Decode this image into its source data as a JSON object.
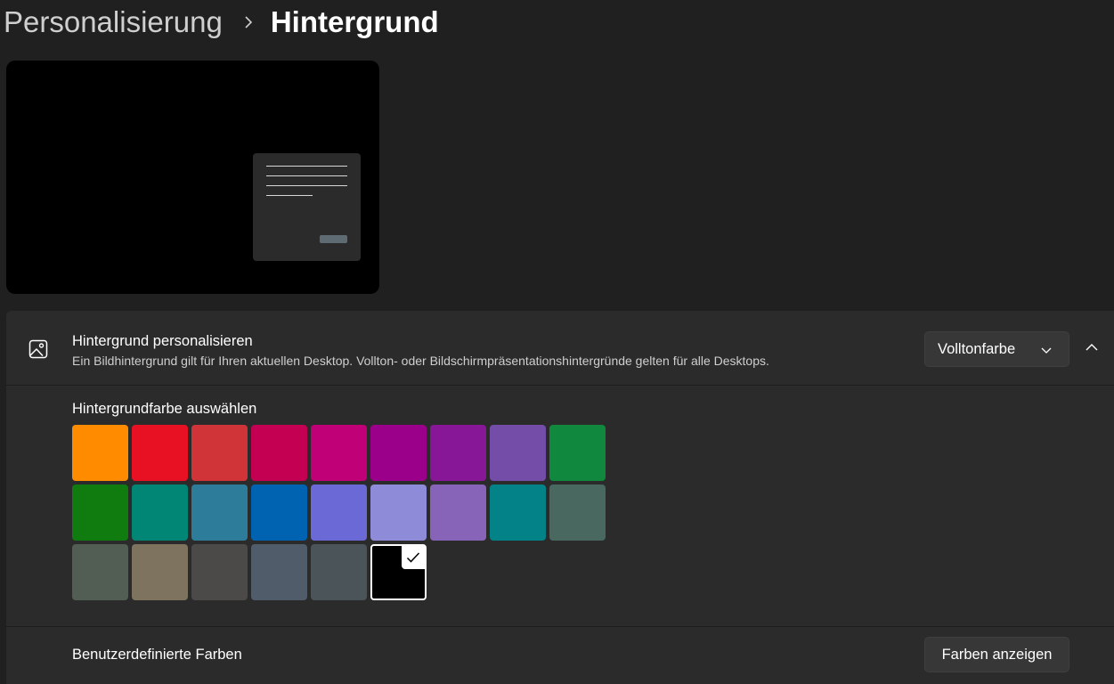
{
  "breadcrumb": {
    "parent": "Personalisierung",
    "current": "Hintergrund"
  },
  "personalize": {
    "title": "Hintergrund personalisieren",
    "description": "Ein Bildhintergrund gilt für Ihren aktuellen Desktop. Vollton- oder Bildschirmpräsentationshintergründe gelten für alle Desktops.",
    "dropdown_value": "Volltonfarbe",
    "icon": "image-icon",
    "collapse_icon": "chevron-up-icon"
  },
  "colors": {
    "label": "Hintergrundfarbe auswählen",
    "selected_index": 23,
    "swatches": [
      "#ff8c00",
      "#e81123",
      "#d13438",
      "#c30052",
      "#bf0077",
      "#9a0089",
      "#881798",
      "#744da9",
      "#10893e",
      "#107c10",
      "#018574",
      "#2d7d9a",
      "#0063b1",
      "#6b69d6",
      "#8e8cd8",
      "#8764b8",
      "#038387",
      "#486860",
      "#525e54",
      "#7e735f",
      "#4c4a48",
      "#515c6b",
      "#4a5459",
      "#000000"
    ]
  },
  "custom_colors": {
    "label": "Benutzerdefinierte Farben",
    "button_label": "Farben anzeigen"
  }
}
